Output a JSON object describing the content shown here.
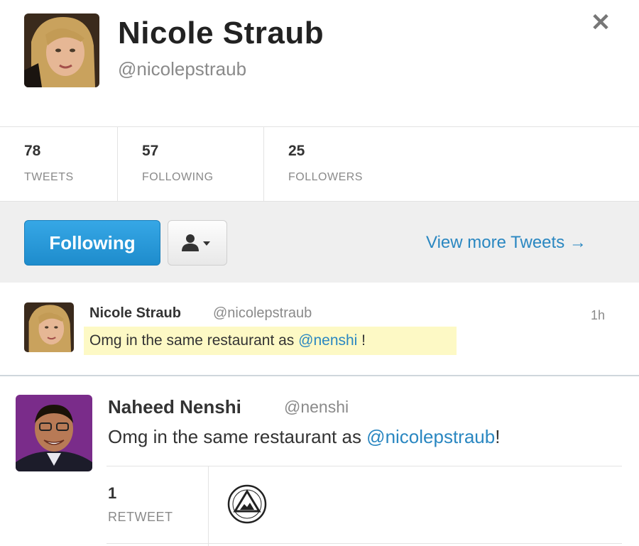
{
  "profile": {
    "name": "Nicole Straub",
    "handle": "@nicolepstraub",
    "close_icon": "close-icon"
  },
  "stats": [
    {
      "value": "78",
      "label": "TWEETS"
    },
    {
      "value": "57",
      "label": "FOLLOWING"
    },
    {
      "value": "25",
      "label": "FOLLOWERS"
    }
  ],
  "actions": {
    "following_label": "Following",
    "user_menu_icon": "user-dropdown-icon",
    "view_more": "View more Tweets →"
  },
  "tweet1": {
    "name": "Nicole Straub",
    "handle": "@nicolepstraub",
    "time": "1h",
    "text_before": "Omg in the same restaurant as ",
    "mention": "@nenshi",
    "text_after": " !"
  },
  "tweet2": {
    "name": "Naheed Nenshi",
    "handle": "@nenshi",
    "text_before": "Omg in the same restaurant as ",
    "mention": "@nicolepstraub",
    "text_after": "!",
    "retweet_count": "1",
    "retweet_label": "RETWEET"
  },
  "colors": {
    "accent": "#2a87c1",
    "button": "#1e8ccc",
    "highlight": "#fdf9c5"
  }
}
